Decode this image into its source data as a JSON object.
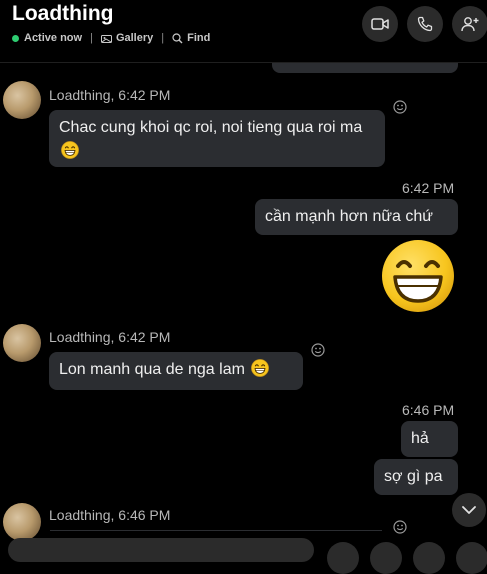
{
  "header": {
    "title": "Loadthing",
    "status": "Active now",
    "gallery_label": "Gallery",
    "find_label": "Find",
    "separator": "|"
  },
  "messages": [
    {
      "type": "incoming",
      "sender": "Loadthing, 6:42 PM",
      "text": "Chac cung khoi qc roi, noi tieng qua roi ma",
      "emoji": "grin-emoji"
    },
    {
      "type": "outgoing",
      "time": "6:42 PM",
      "text": "cần mạnh hơn nữa chứ",
      "sticker": "big-grin-emoji"
    },
    {
      "type": "incoming",
      "sender": "Loadthing, 6:42 PM",
      "text": "Lon manh qua de nga lam",
      "emoji": "grin-emoji"
    },
    {
      "type": "outgoing",
      "time": "6:46 PM",
      "texts": [
        "hả",
        "sợ gì pa"
      ]
    },
    {
      "type": "incoming",
      "sender": "Loadthing, 6:46 PM"
    }
  ],
  "colors": {
    "background": "#000000",
    "bubble": "#2b2d31",
    "active_dot": "#2ecc71",
    "emoji_yellow": "#f7c51e"
  },
  "icons": [
    "video-call-icon",
    "voice-call-icon",
    "add-person-icon",
    "gallery-icon",
    "find-icon",
    "reaction-icon",
    "scroll-down-icon"
  ]
}
